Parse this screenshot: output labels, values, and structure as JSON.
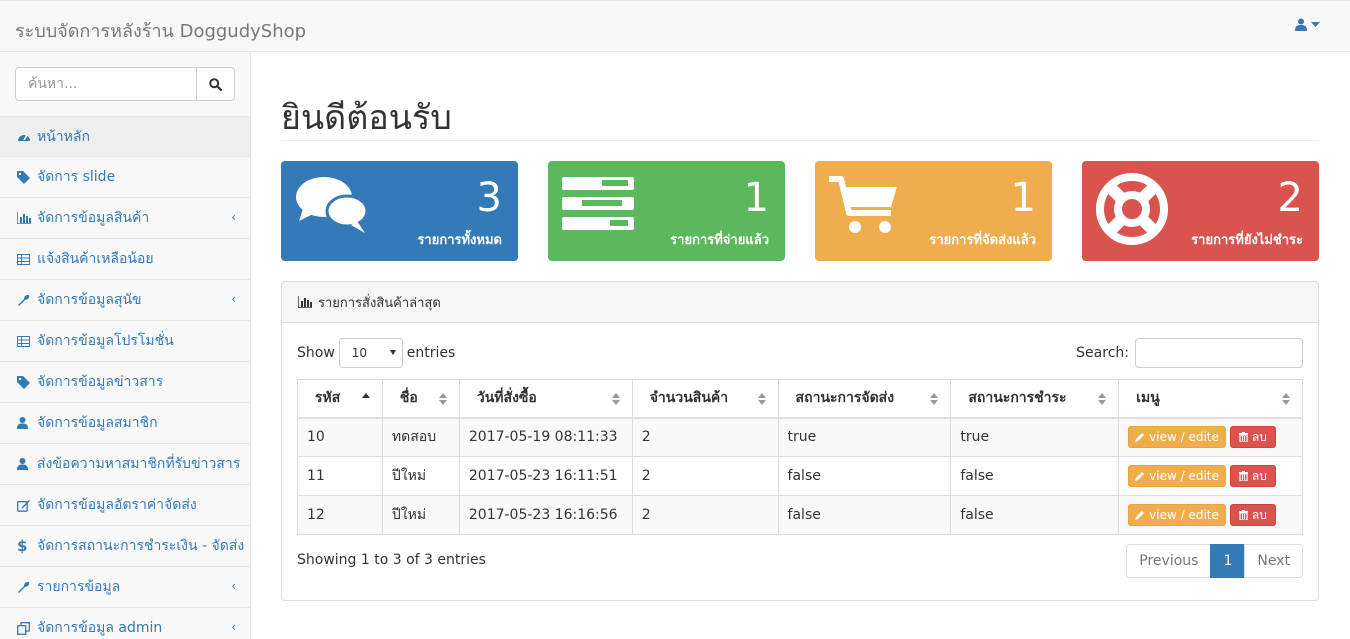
{
  "brand": "ระบบจัดการหลังร้าน DoggudyShop",
  "search": {
    "placeholder": "ค้นหา..."
  },
  "sidebar": {
    "items": [
      {
        "label": "หน้าหลัก",
        "icon": "dashboard-icon",
        "submenu": false,
        "active": true
      },
      {
        "label": "จัดการ slide",
        "icon": "tag-icon",
        "submenu": false
      },
      {
        "label": "จัดการข้อมูลสินค้า",
        "icon": "bar-chart-icon",
        "submenu": true
      },
      {
        "label": "แจ้งสินค้าเหลือน้อย",
        "icon": "table-icon",
        "submenu": false
      },
      {
        "label": "จัดการข้อมูลสุนัข",
        "icon": "wrench-icon",
        "submenu": true
      },
      {
        "label": "จัดการข้อมูลโปรโมชั่น",
        "icon": "table-icon",
        "submenu": false
      },
      {
        "label": "จัดการข้อมูลข่าวสาร",
        "icon": "tag-icon",
        "submenu": false
      },
      {
        "label": "จัดการข้อมูลสมาชิก",
        "icon": "user-icon",
        "submenu": false
      },
      {
        "label": "ส่งข้อความหาสมาชิกที่รับข่าวสาร",
        "icon": "user-icon",
        "submenu": false
      },
      {
        "label": "จัดการข้อมูลอัตราค่าจัดส่ง",
        "icon": "edit-icon",
        "submenu": false
      },
      {
        "label": "จัดการสถานะการชำระเงิน - จัดส่ง",
        "icon": "dollar-icon",
        "submenu": false
      },
      {
        "label": "รายการข้อมูล",
        "icon": "wrench-icon",
        "submenu": true
      },
      {
        "label": "จัดการข้อมูล admin",
        "icon": "copy-icon",
        "submenu": true
      }
    ]
  },
  "main": {
    "title": "ยินดีต้อนรับ",
    "panels": [
      {
        "value": "3",
        "label": "รายการทั้งหมด",
        "icon": "comments-icon",
        "color": "#337ab7"
      },
      {
        "value": "1",
        "label": "รายการที่จ่ายแล้ว",
        "icon": "tasks-icon",
        "color": "#5cb85c"
      },
      {
        "value": "1",
        "label": "รายการที่จัดส่งแล้ว",
        "icon": "shopping-cart-icon",
        "color": "#f0ad4e"
      },
      {
        "value": "2",
        "label": "รายการที่ยังไม่ชำระ",
        "icon": "life-ring-icon",
        "color": "#d9534f"
      }
    ],
    "orders": {
      "heading": "รายการสั่งสินค้าล่าสุด",
      "show_label": "Show",
      "length_value": "10",
      "entries_label": "entries",
      "search_label": "Search:",
      "columns": [
        "รหัส",
        "ชื่อ",
        "วันที่สั่งซื้อ",
        "จำนวนสินค้า",
        "สถานะการจัดส่ง",
        "สถานะการชำระ",
        "เมนู"
      ],
      "rows": [
        [
          "10",
          "ทดสอบ",
          "2017-05-19 08:11:33",
          "2",
          "true",
          "true"
        ],
        [
          "11",
          "ปีใหม่",
          "2017-05-23 16:11:51",
          "2",
          "false",
          "false"
        ],
        [
          "12",
          "ปีใหม่",
          "2017-05-23 16:16:56",
          "2",
          "false",
          "false"
        ]
      ],
      "view_label": "view / edite",
      "delete_label": "ลบ",
      "info": "Showing 1 to 3 of 3 entries",
      "prev_label": "Previous",
      "current_page": "1",
      "next_label": "Next"
    }
  }
}
